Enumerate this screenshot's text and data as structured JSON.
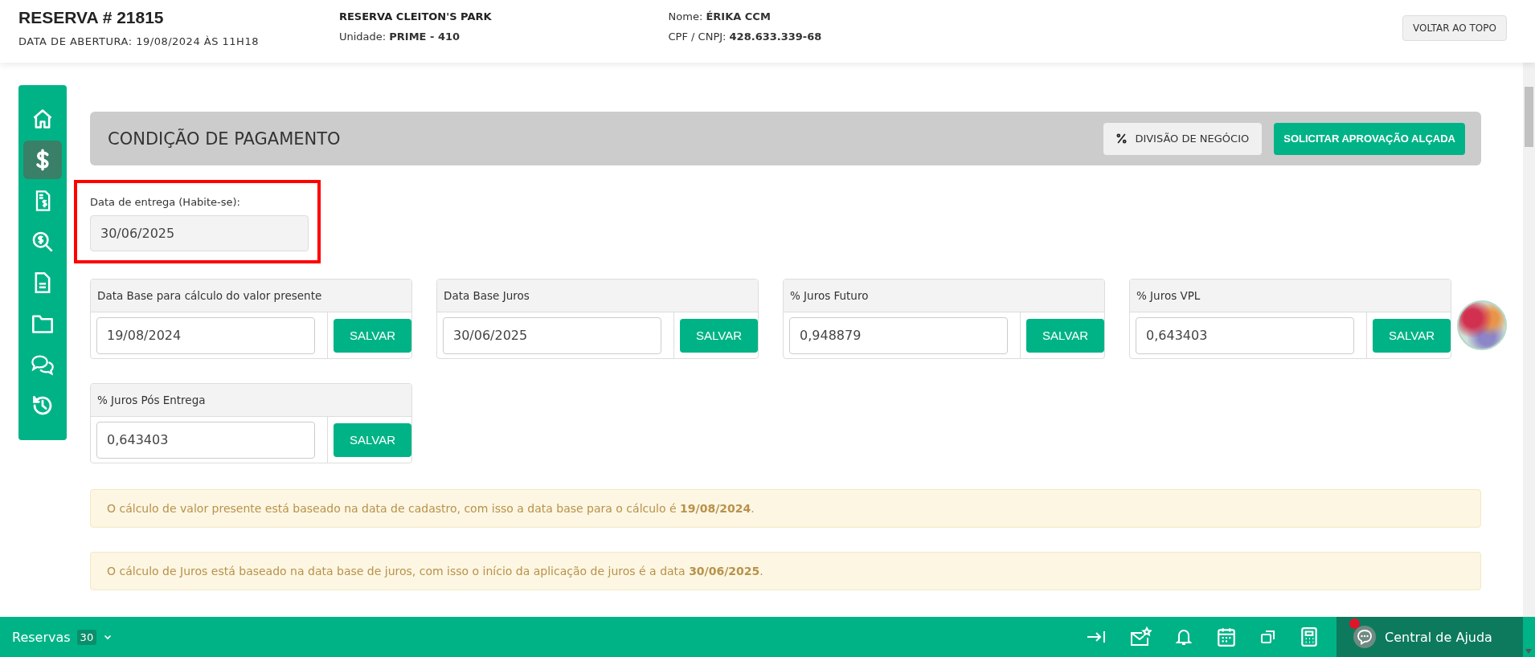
{
  "header": {
    "title": "RESERVA # 21815",
    "opening_date": "DATA DE ABERTURA: 19/08/2024 ÀS 11H18",
    "reservation_name": "RESERVA CLEITON'S PARK",
    "unit": "Unidade: **PRIME - 410**",
    "client_name": "Nome: **ÉRIKA CCM**",
    "document": "CPF / CNPJ: **428.633.339-68**",
    "top_button": "VOLTAR AO TOPO"
  },
  "sidebar": {
    "items": [
      {
        "selected": false
      },
      {
        "selected": true
      },
      {
        "selected": false
      },
      {
        "selected": false
      },
      {
        "selected": false
      },
      {
        "selected": false
      },
      {
        "selected": false
      },
      {
        "selected": false
      }
    ]
  },
  "section": {
    "title": "CONDIÇÃO DE PAGAMENTO",
    "buttons": [
      {
        "kind": "secondary",
        "label": "DIVISÃO DE NEGÓCIO"
      },
      {
        "kind": "primary",
        "label": "SOLICITAR APROVAÇÃO ALÇADA"
      }
    ]
  },
  "delivery": {
    "label": "Data de entrega (Habite-se):",
    "value": "30/06/2025",
    "highlighted": true
  },
  "rate_cards": [
    {
      "label": "Data Base para cálculo do valor presente",
      "value": "19/08/2024",
      "button": "SALVAR"
    },
    {
      "label": "Data Base Juros",
      "value": "30/06/2025",
      "button": "SALVAR"
    },
    {
      "label": "% Juros Futuro",
      "value": "0,948879",
      "button": "SALVAR"
    },
    {
      "label": "% Juros VPL",
      "value": "0,643403",
      "button": "SALVAR"
    },
    {
      "label": "% Juros Pós Entrega",
      "value": "0,643403",
      "button": "SALVAR"
    }
  ],
  "notices": [
    "O cálculo de valor presente está baseado na data de cadastro, com isso a data base para o cálculo é **19/08/2024**.",
    "O cálculo de Juros está baseado na data base de juros, com isso o início da aplicação de juros é a data **30/06/2025**."
  ],
  "bottom_bar": {
    "label": "Reservas",
    "count": "30",
    "help_label": "Central de Ajuda",
    "notification": true
  }
}
